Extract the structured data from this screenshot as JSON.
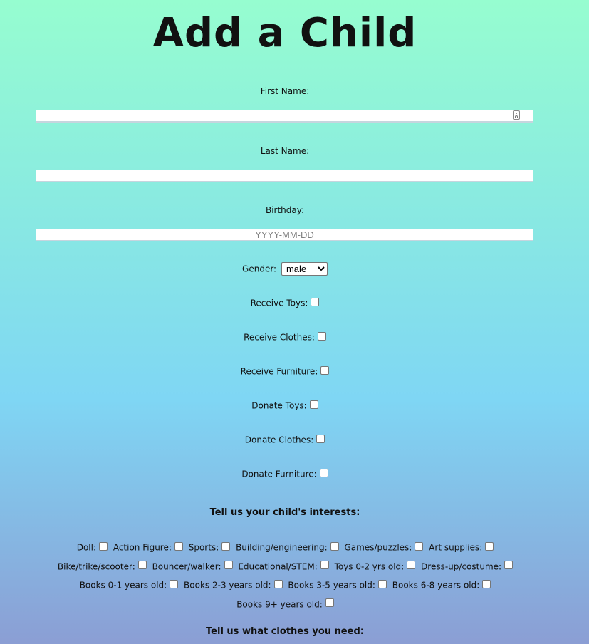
{
  "title": "Add a Child",
  "fields": {
    "first_name_label": "First Name:",
    "first_name_value": "",
    "last_name_label": "Last Name:",
    "last_name_value": "",
    "birthday_label": "Birthday:",
    "birthday_placeholder": "YYYY-MM-DD",
    "gender_label": "Gender:",
    "gender_selected": "male"
  },
  "preferences": [
    {
      "label": "Receive Toys:",
      "checked": false
    },
    {
      "label": "Receive Clothes:",
      "checked": false
    },
    {
      "label": "Receive Furniture:",
      "checked": false
    },
    {
      "label": "Donate Toys:",
      "checked": false
    },
    {
      "label": "Donate Clothes:",
      "checked": false
    },
    {
      "label": "Donate Furniture:",
      "checked": false
    }
  ],
  "interests_heading": "Tell us your child's interests:",
  "interests": [
    "Doll:",
    "Action Figure:",
    "Sports:",
    "Building/engineering:",
    "Games/puzzles:",
    "Art supplies:",
    "Bike/trike/scooter:",
    "Bouncer/walker:",
    "Educational/STEM:",
    "Toys 0-2 yrs old:",
    "Dress-up/costume:",
    "Books 0-1 years old:",
    "Books 2-3 years old:",
    "Books 3-5 years old:",
    "Books 6-8 years old:",
    "Books 9+ years old:"
  ],
  "clothes_heading": "Tell us what clothes you need:"
}
